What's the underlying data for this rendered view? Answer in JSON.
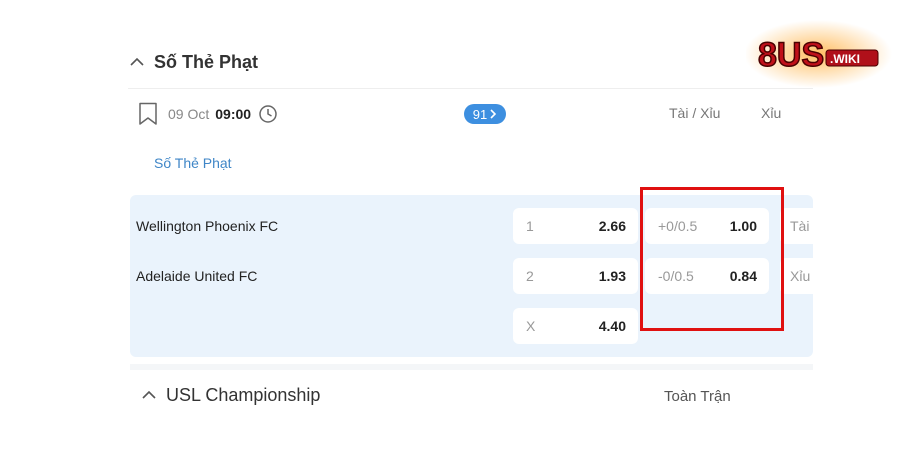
{
  "section": {
    "title": "Số Thẻ Phạt"
  },
  "event": {
    "date": "09 Oct",
    "time": "09:00",
    "markets_count": "91",
    "column_over_under": "Tài / Xỉu",
    "column_under": "Xỉu",
    "league_link": "Số Thẻ Phạt"
  },
  "match": {
    "home_team": "Wellington Phoenix FC",
    "away_team": "Adelaide United FC",
    "moneyline": [
      {
        "label": "1",
        "value": "2.66"
      },
      {
        "label": "2",
        "value": "1.93"
      },
      {
        "label": "X",
        "value": "4.40"
      }
    ],
    "handicap": [
      {
        "label": "+0/0.5",
        "value": "1.00"
      },
      {
        "label": "-0/0.5",
        "value": "0.84"
      }
    ],
    "over_under_partial": [
      "Tài",
      "Xỉu"
    ]
  },
  "next_section": {
    "title": "USL Championship",
    "column": "Toàn Trận"
  },
  "logo": {
    "text": "8US",
    "subtext": ".WIKI"
  },
  "colors": {
    "accent": "#3d8fe0",
    "highlight": "#e01010",
    "panel": "#eaf3fc",
    "link": "#3f86c7"
  },
  "icons": [
    "chevron-up-icon",
    "bookmark-icon",
    "clock-icon",
    "chevron-right-icon"
  ]
}
